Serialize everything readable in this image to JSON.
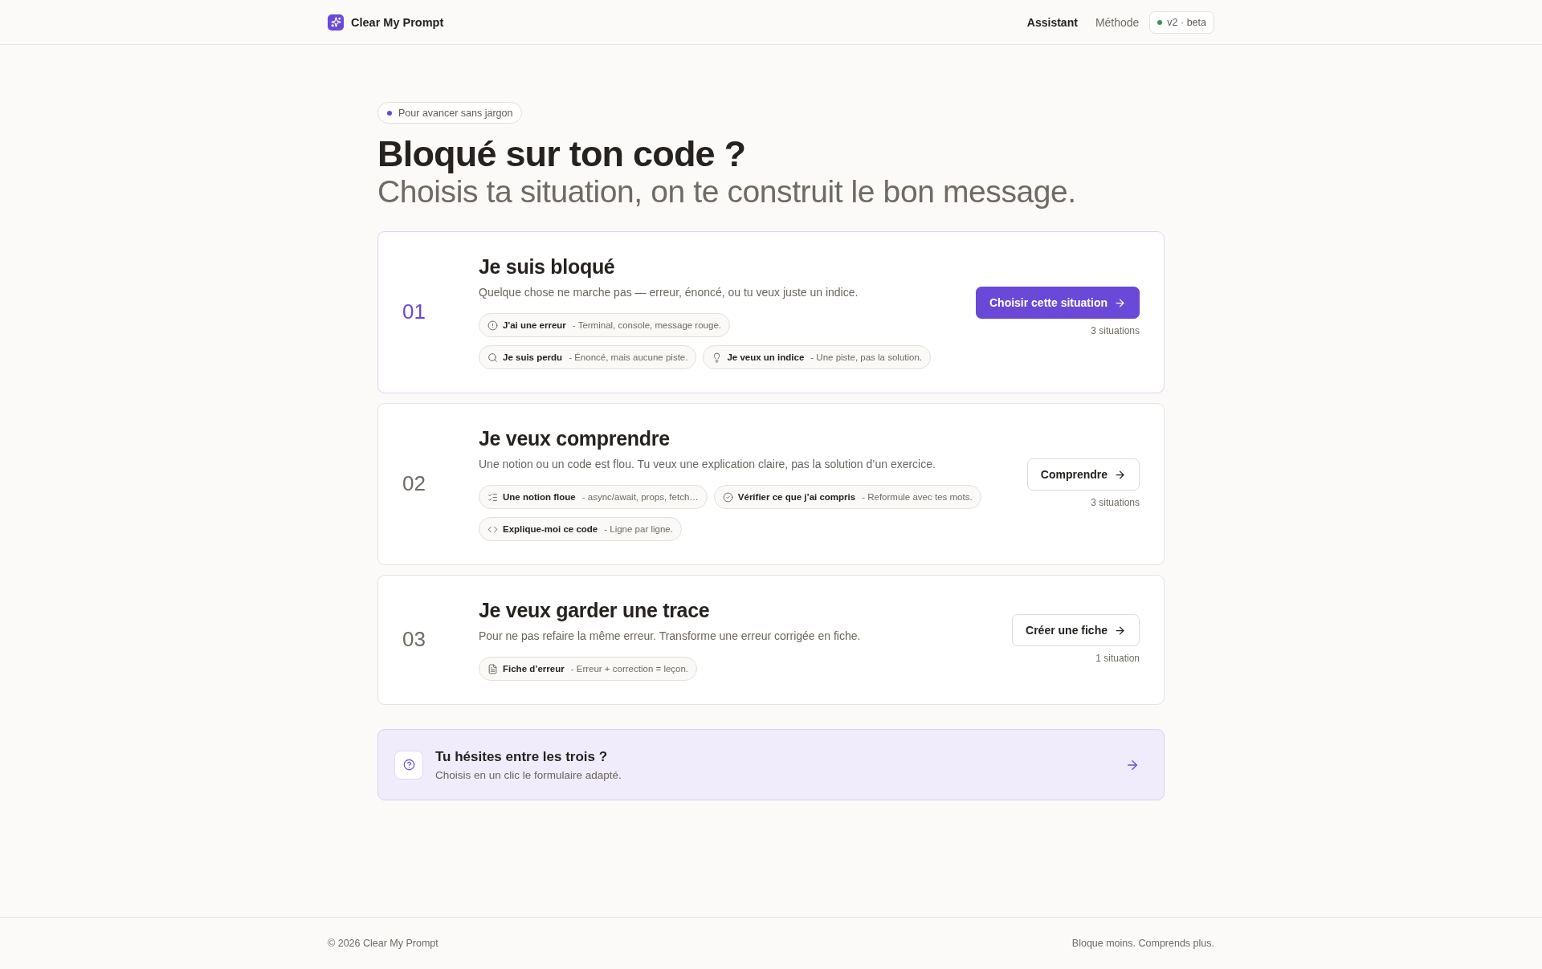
{
  "header": {
    "brand": "Clear My Prompt",
    "nav": [
      {
        "label": "Assistant",
        "selected": true
      },
      {
        "label": "Méthode",
        "selected": false
      }
    ],
    "version_badge": "v2 · beta"
  },
  "hero": {
    "eyebrow": "Pour avancer sans jargon",
    "title": "Bloqué sur ton code ?",
    "subtitle": "Choisis ta situation, on te construit le bon message."
  },
  "situations": [
    {
      "number": "01",
      "title": "Je suis bloqué",
      "description": "Quelque chose ne marche pas — erreur, énoncé, ou tu veux juste un indice.",
      "selected": true,
      "options": [
        {
          "kind": "error",
          "label": "J'ai une erreur",
          "detail": "- Terminal, console, message rouge."
        },
        {
          "kind": "lost",
          "label": "Je suis perdu",
          "detail": "- Énoncé, mais aucune piste."
        },
        {
          "kind": "hint",
          "label": "Je veux un indice",
          "detail": "- Une piste, pas la solution."
        }
      ],
      "action": "Choisir cette situation",
      "count": "3 situations"
    },
    {
      "number": "02",
      "title": "Je veux comprendre",
      "description": "Une notion ou un code est flou. Tu veux une explication claire, pas la solution d’un exercice.",
      "selected": false,
      "options": [
        {
          "kind": "notion",
          "label": "Une notion floue",
          "detail": "- async/await, props, fetch…"
        },
        {
          "kind": "verify",
          "label": "Vérifier ce que j’ai compris",
          "detail": "- Reformule avec tes mots."
        },
        {
          "kind": "code",
          "label": "Explique-moi ce code",
          "detail": "- Ligne par ligne."
        }
      ],
      "action": "Comprendre",
      "count": "3 situations"
    },
    {
      "number": "03",
      "title": "Je veux garder une trace",
      "description": "Pour ne pas refaire la même erreur. Transforme une erreur corrigée en fiche.",
      "selected": false,
      "options": [
        {
          "kind": "sheet",
          "label": "Fiche d’erreur",
          "detail": "- Erreur + correction = leçon."
        }
      ],
      "action": "Créer une fiche",
      "count": "1 situation"
    }
  ],
  "help": {
    "title": "Tu hésites entre les trois ?",
    "subtitle": "Choisis en un clic le formulaire adapté."
  },
  "footer": {
    "copyright": "© 2026 Clear My Prompt",
    "tagline": "Bloque moins. Comprends plus."
  }
}
